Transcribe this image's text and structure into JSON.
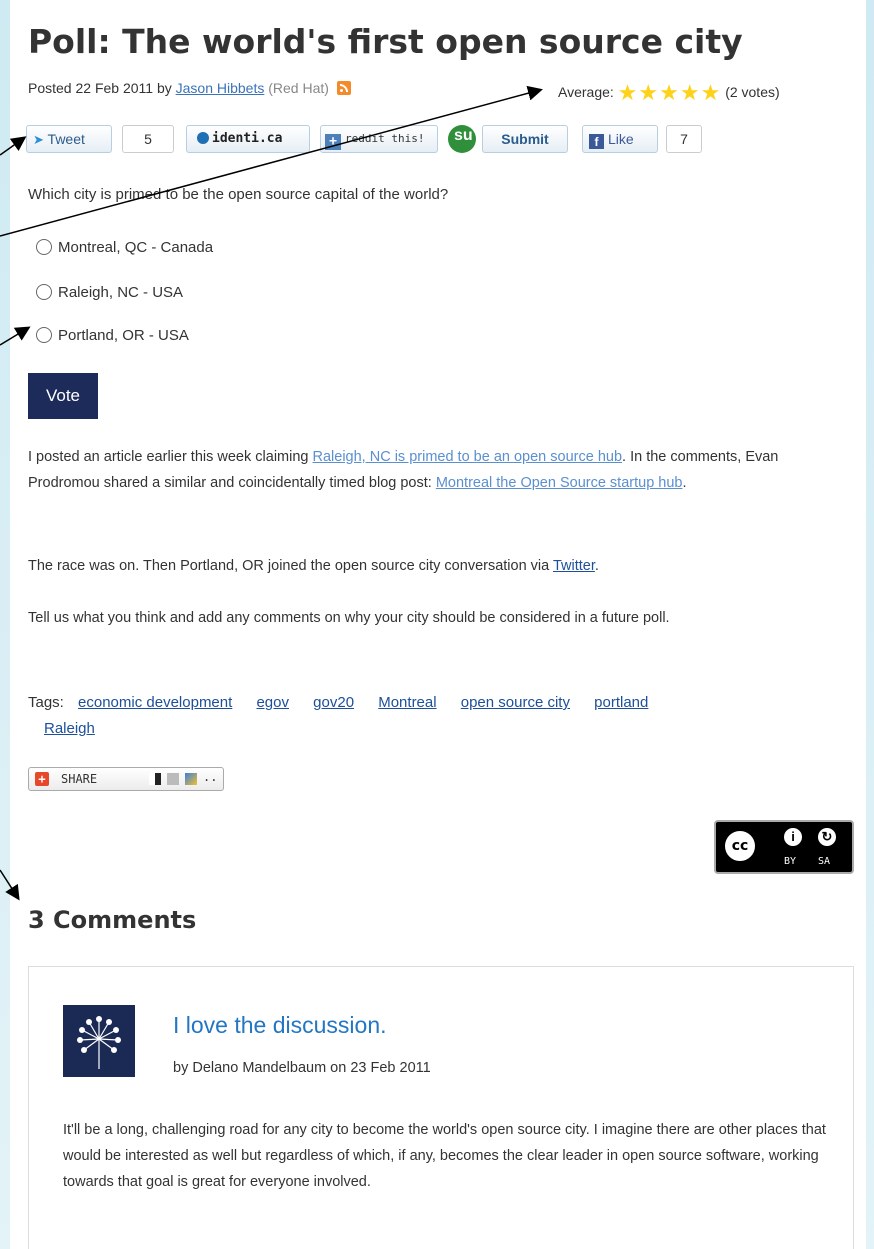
{
  "post": {
    "title": "Poll: The world's first open source city",
    "posted_prefix": "Posted 22 Feb 2011 by",
    "author": "Jason Hibbets",
    "org": "(Red Hat)",
    "average_label": "Average:",
    "stars": "★★★★★",
    "rating_value": 5,
    "votes": "(2 votes)"
  },
  "social": {
    "tweet": "Tweet",
    "tweet_count": "5",
    "identica": "identi.ca",
    "reddit": "reddit this!",
    "stumble": "Submit",
    "like": "Like",
    "like_count": "7"
  },
  "poll": {
    "question": "Which city is primed to be the open source capital of the world?",
    "options": [
      "Montreal, QC - Canada",
      "Raleigh, NC - USA",
      "Portland, OR - USA"
    ],
    "vote_button": "Vote"
  },
  "body": {
    "p1_a": "I posted an article earlier this week claiming ",
    "p1_link1": "Raleigh, NC is primed to be an open source hub",
    "p1_b": ". In the comments, Evan Prodromou shared a similar and coincidentally timed blog post: ",
    "p1_link2": "Montreal the Open Source startup hub",
    "p1_c": ".",
    "p2_a": "The race was on. Then Portland, OR joined the open source city conversation via ",
    "p2_link": "Twitter",
    "p2_b": ".",
    "p3": "Tell us what you think and add any comments on why your city should be considered in a future poll."
  },
  "tags": {
    "label": "Tags:",
    "items": [
      "economic development",
      "egov",
      "gov20",
      "Montreal",
      "open source city",
      "portland",
      "Raleigh"
    ]
  },
  "share": {
    "label": "SHARE"
  },
  "license": {
    "by": "BY",
    "sa": "SA"
  },
  "comments": {
    "title": "3 Comments",
    "first": {
      "heading": "I love the discussion.",
      "byline": "by Delano Mandelbaum on 23 Feb 2011",
      "text": "It'll be a long, challenging road for any city to become the world's open source city. I imagine there are other places that would be interested as well but regardless of which, if any, becomes the clear leader in open source software, working towards that goal is great for everyone involved."
    }
  },
  "colors": {
    "link": "#3b73b9",
    "vote_bg": "#1d2b5b",
    "star": "#ffd21a",
    "comment_heading": "#2376c3"
  }
}
